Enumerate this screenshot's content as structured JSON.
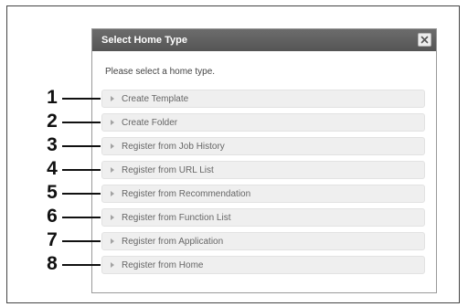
{
  "dialog": {
    "title": "Select Home Type",
    "close_icon": "close-icon",
    "prompt": "Please select a home type.",
    "options": [
      {
        "label": "Create Template",
        "callout": "1"
      },
      {
        "label": "Create Folder",
        "callout": "2"
      },
      {
        "label": "Register from Job History",
        "callout": "3"
      },
      {
        "label": "Register from URL List",
        "callout": "4"
      },
      {
        "label": "Register from Recommendation",
        "callout": "5"
      },
      {
        "label": "Register from Function List",
        "callout": "6"
      },
      {
        "label": "Register from Application",
        "callout": "7"
      },
      {
        "label": "Register from Home",
        "callout": "8"
      }
    ]
  },
  "colors": {
    "titlebar": "#5e5e5e",
    "option_bg": "#efefef",
    "option_text": "#666666",
    "callout": "#111111"
  }
}
